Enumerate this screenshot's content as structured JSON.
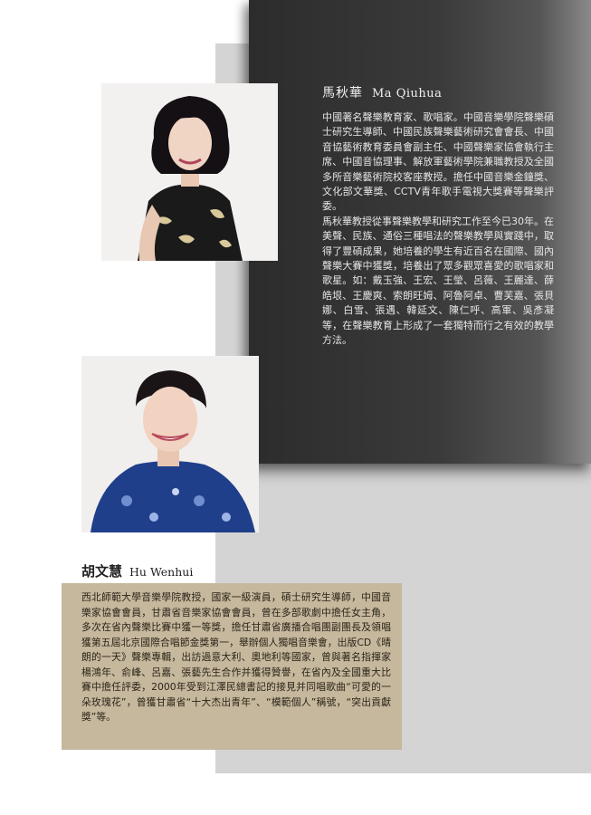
{
  "person1": {
    "name_cn": "馬秋華",
    "name_en": "Ma Qiuhua",
    "bio_paragraphs": [
      "中國著名聲樂教育家、歌唱家。中國音樂學院聲樂碩士研究生導師、中國民族聲樂藝術研究會會長、中國音協藝術教育委員會副主任、中國聲樂家協會執行主席、中國音協理事、解放軍藝術學院兼職教授及全國多所音樂藝術院校客座教授。擔任中國音樂金鐘獎、文化部文華獎、CCTV青年歌手電視大獎賽等聲樂評委。",
      "馬秋華教授從事聲樂教學和研究工作至今已30年。在美聲、民族、通俗三種唱法的聲樂教學與實踐中，取得了豐碩成果，她培養的學生有近百名在國際、國內聲樂大賽中獲獎，培養出了眾多觀眾喜愛的歌唱家和歌星。如：戴玉強、王宏、王瑩、呂薇、王麗達、薛皓垠、王慶爽、索朗旺姆、阿魯阿卓、曹芙嘉、張貝娜、白雪、張遇、韓延文、陳仁呼、高軍、吳彥凝等，在聲樂教育上形成了一套獨特而行之有效的教學方法。"
    ],
    "photo_label": "portrait-ma-qiuhua"
  },
  "person2": {
    "name_cn": "胡文慧",
    "name_en": "Hu Wenhui",
    "bio": "西北師範大學音樂學院教授，國家一級演員，碩士研究生導師，中國音樂家協會會員，甘肅省音樂家協會會員，曾在多部歌劇中擔任女主角，多次在省內聲樂比賽中獲一等獎，擔任甘肅省廣播合唱團副團長及領唱獲第五屆北京國際合唱節金獎第一，舉辦個人獨唱音樂會，出版CD《晴朗的一天》聲樂專輯，出訪過意大利、奧地利等國家，曾與著名指揮家楊鴻年、俞峰、呂嘉、張藝先生合作并獲得贊譽，在省內及全國重大比賽中擔任評委，2000年受到江澤民總書記的接見并同唱歌曲“可愛的一朵玫瑰花”，曾獲甘肅省“十大杰出青年”、“模範個人”稱號，“突出貢獻獎”等。",
    "photo_label": "portrait-hu-wenhui"
  },
  "colors": {
    "dark_panel": "#2c2c2c",
    "gray_band": "#d4d4d4",
    "bio_box": "#c6b89d"
  }
}
